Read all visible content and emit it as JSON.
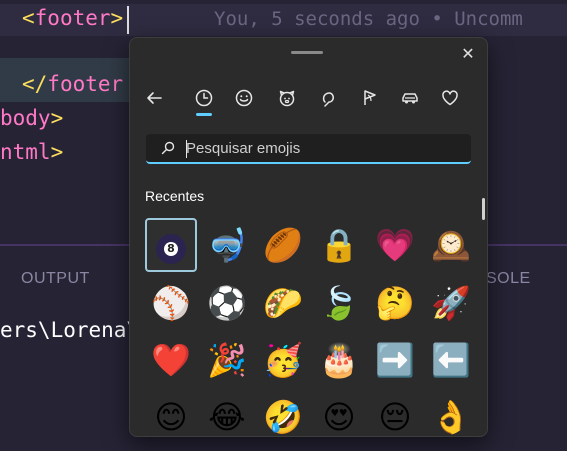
{
  "editor": {
    "line1_lt": "<",
    "line1_tag": "footer",
    "line1_gt": ">",
    "blame": "You, 5 seconds ago • Uncomm",
    "line2_lt": "</",
    "line2_tag": "footer",
    "line3_tag": "body",
    "line3_gt": ">",
    "line4_tag": "ntml",
    "line4_gt": ">"
  },
  "panel": {
    "output_tab": "OUTPUT",
    "console_tab": "SOLE",
    "terminal_text": "ers\\Lorena\\"
  },
  "picker": {
    "close_label": "✕",
    "search_placeholder": "Pesquisar emojis",
    "section_title": "Recentes",
    "categories": [
      "recent-icon",
      "smiley-icon",
      "animal-icon",
      "food-icon",
      "activity-icon",
      "car-icon",
      "heart-icon"
    ],
    "accent": "#60cdff",
    "emojis": [
      [
        "8-ball",
        "🤿",
        "🏉",
        "🔒",
        "💗",
        "🕰️"
      ],
      [
        "⚾",
        "⚽",
        "🌮",
        "🍃",
        "🤔",
        "🚀"
      ],
      [
        "❤️",
        "🎉",
        "🥳",
        "🎂",
        "➡️",
        "⬅️"
      ],
      [
        "😊",
        "😂",
        "🤣",
        "😍",
        "😔",
        "👌"
      ]
    ]
  }
}
